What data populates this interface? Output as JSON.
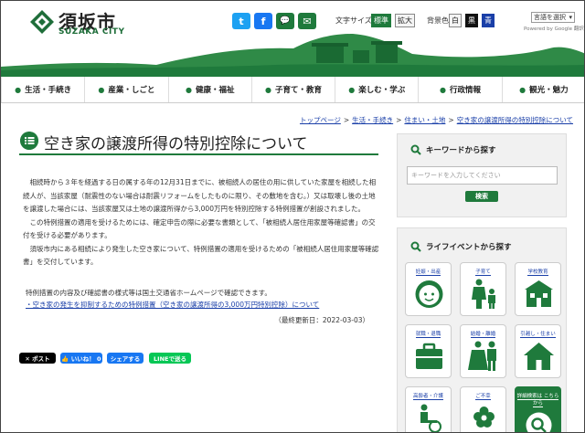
{
  "header": {
    "logo_jp": "須坂市",
    "logo_en": "SUZAKA CITY",
    "sns": {
      "twitter": "t",
      "facebook": "f",
      "line": "💬",
      "mail": "✉"
    },
    "font_size_label": "文字サイズ",
    "font_standard": "標準",
    "font_large": "拡大",
    "bg_color_label": "背景色",
    "bg_white": "白",
    "bg_black": "黒",
    "bg_blue": "青",
    "lang_select": "言語を選択",
    "powered_by": "Powered by Google 翻訳"
  },
  "nav": [
    {
      "label": "生活・手続き"
    },
    {
      "label": "産業・しごと"
    },
    {
      "label": "健康・福祉"
    },
    {
      "label": "子育て・教育"
    },
    {
      "label": "楽しむ・学ぶ"
    },
    {
      "label": "行政情報"
    },
    {
      "label": "観光・魅力"
    }
  ],
  "breadcrumb": [
    "トップページ",
    "生活・手続き",
    "住まい・土地",
    "空き家の譲渡所得の特別控除について"
  ],
  "page_title": "空き家の譲渡所得の特別控除について",
  "body": {
    "p1": "相続時から３年を経過する日の属する年の12月31日までに、被相続人の居住の用に供していた家屋を相続した相続人が、当該家屋（耐震性のない場合は耐震リフォームをしたものに限り、その敷地を含む。）又は取壊し後の土地を譲渡した場合には、当該家屋又は土地の譲渡所得から3,000万円を特別控除する特例措置が創設されました。",
    "p2": "この特例措置の適用を受けるためには、確定申告の際に必要な書類として、「被相続人居住用家屋等確認書」の交付を受ける必要があります。",
    "p3": "須坂市内にある相続により発生した空き家について、特例措置の適用を受けるための「被相続人居住用家屋等確認書」を交付しています。",
    "note": "特例措置の内容及び確認書の様式等は国土交通省ホームページで確認できます。",
    "link": "・空き家の発生を抑制するための特例措置（空き家の譲渡所得の3,000万円特別控除）について",
    "updated": "（最終更新日：2022-03-03）"
  },
  "share": {
    "x_post": "✕ ポスト",
    "like": "👍 いいね！ 0",
    "facebook_share": "シェアする",
    "line_share": "LINEで送る"
  },
  "sidebar": {
    "keyword_title": "キーワードから探す",
    "search_placeholder": "キーワードを入力してください",
    "search_button": "検索",
    "life_title": "ライフイベントから探す",
    "tiles": [
      {
        "label": "妊娠・出産",
        "icon": "baby-face-icon"
      },
      {
        "label": "子育て",
        "icon": "parent-child-icon"
      },
      {
        "label": "学校教育",
        "icon": "school-icon"
      },
      {
        "label": "就職・退職",
        "icon": "briefcase-icon"
      },
      {
        "label": "結婚・離婚",
        "icon": "wedding-couple-icon"
      },
      {
        "label": "引越し・住まい",
        "icon": "house-icon"
      },
      {
        "label": "高齢者・介護",
        "icon": "elderly-icon"
      },
      {
        "label": "ご不幸",
        "icon": "flower-icon"
      },
      {
        "label": "詳細検索は こちらから",
        "icon": "magnifier-icon"
      }
    ]
  },
  "colors": {
    "brand_green": "#1f7a3c",
    "link_blue": "#1a3fa8"
  }
}
